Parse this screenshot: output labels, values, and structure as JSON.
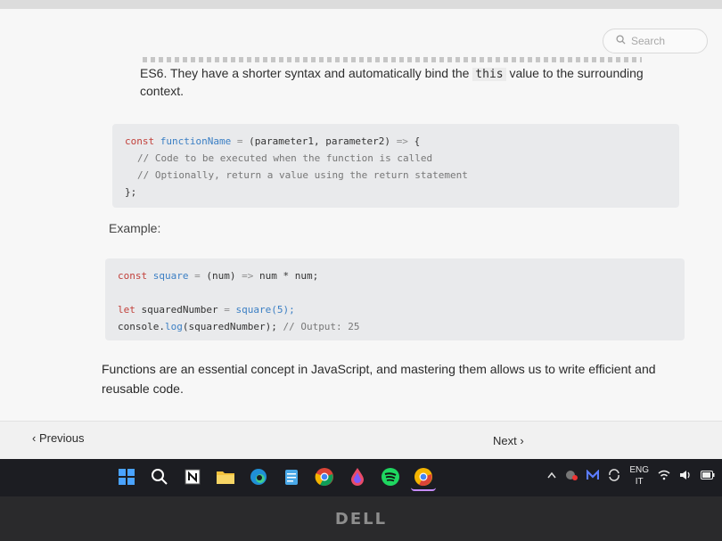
{
  "search": {
    "placeholder": "Search"
  },
  "intro": {
    "text_before": "ES6. They have a shorter syntax and automatically bind the ",
    "inline_code": "this",
    "text_after": " value to the surrounding context."
  },
  "code1": {
    "line1": {
      "kw": "const",
      "name": "functionName",
      "op": "=",
      "rest": "(parameter1, parameter2)",
      "arrow": "=>",
      "brace": "{"
    },
    "line2": "// Code to be executed when the function is called",
    "line3": "// Optionally, return a value using the return statement",
    "line4": "};"
  },
  "example_label": "Example:",
  "code2": {
    "line1": {
      "kw": "const",
      "name": "square",
      "op": "=",
      "params": "(num)",
      "arrow": "=>",
      "body": "num * num;"
    },
    "line3": {
      "kw": "let",
      "name": "squaredNumber",
      "op": "=",
      "call": "square(5);"
    },
    "line4": {
      "obj": "console.",
      "method": "log",
      "args": "(squaredNumber);",
      "comment": "// Output: 25"
    }
  },
  "summary": "Functions are an essential concept in JavaScript, and mastering them allows us to write efficient and reusable code.",
  "nav": {
    "previous": "‹ Previous",
    "next": "Next ›"
  },
  "taskbar": {
    "icons": [
      "windows-start-icon",
      "search-icon",
      "notion-icon",
      "file-explorer-icon",
      "edge-icon",
      "notepad-icon",
      "chrome-icon",
      "drop-icon",
      "spotify-icon",
      "chrome-canary-icon"
    ],
    "tray_lang_line1": "ENG",
    "tray_lang_line2": "IT"
  },
  "bezel_logo": "DELL",
  "colors": {
    "keyword": "#c2413b",
    "function": "#3b7fc4",
    "comment": "#777777",
    "taskbar": "#1c1d22"
  }
}
